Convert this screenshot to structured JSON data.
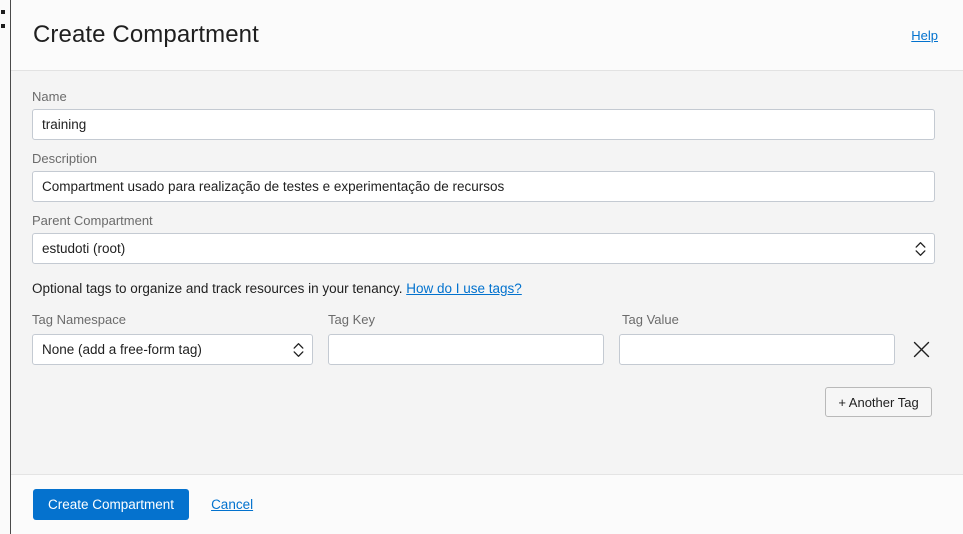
{
  "header": {
    "title": "Create Compartment",
    "help_label": "Help"
  },
  "form": {
    "name": {
      "label": "Name",
      "value": "training",
      "placeholder": ""
    },
    "description": {
      "label": "Description",
      "value": "Compartment usado para realização de testes e experimentação de recursos",
      "placeholder": ""
    },
    "parent_compartment": {
      "label": "Parent Compartment",
      "value": "estudoti (root)",
      "options": [
        "estudoti (root)"
      ]
    }
  },
  "tags": {
    "hint_text": "Optional tags to organize and track resources in your tenancy.",
    "hint_link": "How do I use tags?",
    "columns": {
      "namespace": "Tag Namespace",
      "key": "Tag Key",
      "value": "Tag Value"
    },
    "rows": [
      {
        "namespace_value": "None (add a free-form tag)",
        "namespace_options": [
          "None (add a free-form tag)"
        ],
        "key_value": "",
        "key_placeholder": "",
        "value_value": "",
        "value_placeholder": ""
      }
    ],
    "add_button_label": "+ Another Tag",
    "remove_icon": "close-icon"
  },
  "footer": {
    "submit_label": "Create Compartment",
    "cancel_label": "Cancel"
  },
  "colors": {
    "accent": "#0572ce",
    "link": "#0272ce",
    "label_text": "#6b6b6b",
    "body_text": "#1f1f1f",
    "panel_bg": "#f4f4f4",
    "header_bg": "#fbfbfb",
    "input_border": "#c4cad2"
  }
}
